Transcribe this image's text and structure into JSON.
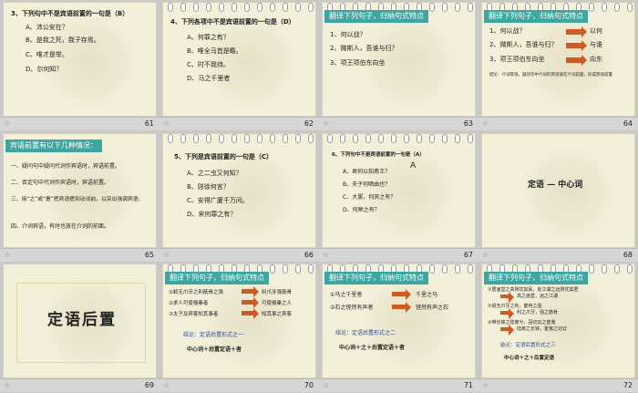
{
  "slides": [
    {
      "num": "61",
      "title": "3、下列句中不是宾语前置的一句是（B）",
      "lines": [
        "A、沛公安在？",
        "B、是我之死，我子存焉。",
        "C、唯才是举。",
        "D、尔何知？"
      ]
    },
    {
      "num": "62",
      "title": "4、下列各项中不是宾语前置的一句是（D）",
      "lines": [
        "A、何罪之有？",
        "B、唯全马首是瞻。",
        "C、时不我待。",
        "D、马之千里者"
      ]
    },
    {
      "num": "63",
      "header": "翻译下列句子，归纳句式特点",
      "lines": [
        "1、何以战？",
        "2、微斯人，吾谁与归？",
        "3、项王项伯东向坐"
      ]
    },
    {
      "num": "64",
      "header": "翻译下列句子，归纳句式特点",
      "lines": [
        "1、何以战？",
        "2、微斯人，吾谁与归？",
        "3、项王项伯东向坐"
      ],
      "answers": [
        "以何",
        "与谁",
        "向东"
      ],
      "note": "结论：介词宾语，疑问句中介词的宾语放在介词前面，形成宾语前置"
    },
    {
      "num": "65",
      "header": "宾语前置有以下几种情况：",
      "lines": [
        "一、疑问句中疑问代词作宾语时，宾语前置。",
        "二、否定句中代词作宾语时，宾语前置。",
        "三、用“之”或“是”把宾语提到动词前，以突出强调宾语。",
        "四、介词宾语，有时也放在介词的前面。"
      ]
    },
    {
      "num": "66",
      "title": "5、下列是宾语前置的一句是（C）",
      "lines": [
        "A、之二虫又何知？",
        "B、则徐何言？",
        "C、安得广厦千万间。",
        "D、宋何罪之有？"
      ]
    },
    {
      "num": "67",
      "title": "6、下列句中不是宾语前置的一句是（A）",
      "mark": "A",
      "lines": [
        "A、君何以知燕王？",
        "B、夫子何哂由也？",
        "C、大罢，何厌之有？",
        "D、何陋之有？"
      ]
    },
    {
      "num": "68",
      "center_title": "定语 — 中心词"
    },
    {
      "num": "69",
      "big_title": "定语后置"
    },
    {
      "num": "70",
      "header": "翻译下列句子，归纳句式特点",
      "lines": [
        "①蚓无爪牙之利筋骨之强",
        "②求人可使报秦者",
        "③太子及宾客知其事者"
      ],
      "answers": [
        "利爪牙强筋骨",
        "可使报秦之人",
        "知其事之宾客"
      ],
      "conclusion": "结论：定语后置形式之一",
      "formula": "中心词＋后置定语＋者"
    },
    {
      "num": "71",
      "header": "翻译下列句子，归纳句式特点",
      "lines": [
        "①马之千里者",
        "②石之铿然有声者"
      ],
      "answers": [
        "千里之马",
        "铿然有声之石"
      ],
      "conclusion": "结论：定语后置形式之二",
      "formula": "中心词＋之＋后置定语＋者"
    },
    {
      "num": "72",
      "header": "翻译下列句子，归纳句式特点",
      "lines": [
        "①居庙堂之高则忧其民，处江湖之远则忧其君",
        "②蚓无爪牙之利，筋骨之强",
        "③带长铗之陆离兮，冠切云之崔嵬"
      ],
      "answers": [
        "高之庙堂，远之江湖",
        "利之爪牙，强之筋骨",
        "陆离之长铗，崔嵬之切云"
      ],
      "conclusion": "结论：定语后置形式之三",
      "formula": "中心词＋之＋后置定语"
    }
  ]
}
